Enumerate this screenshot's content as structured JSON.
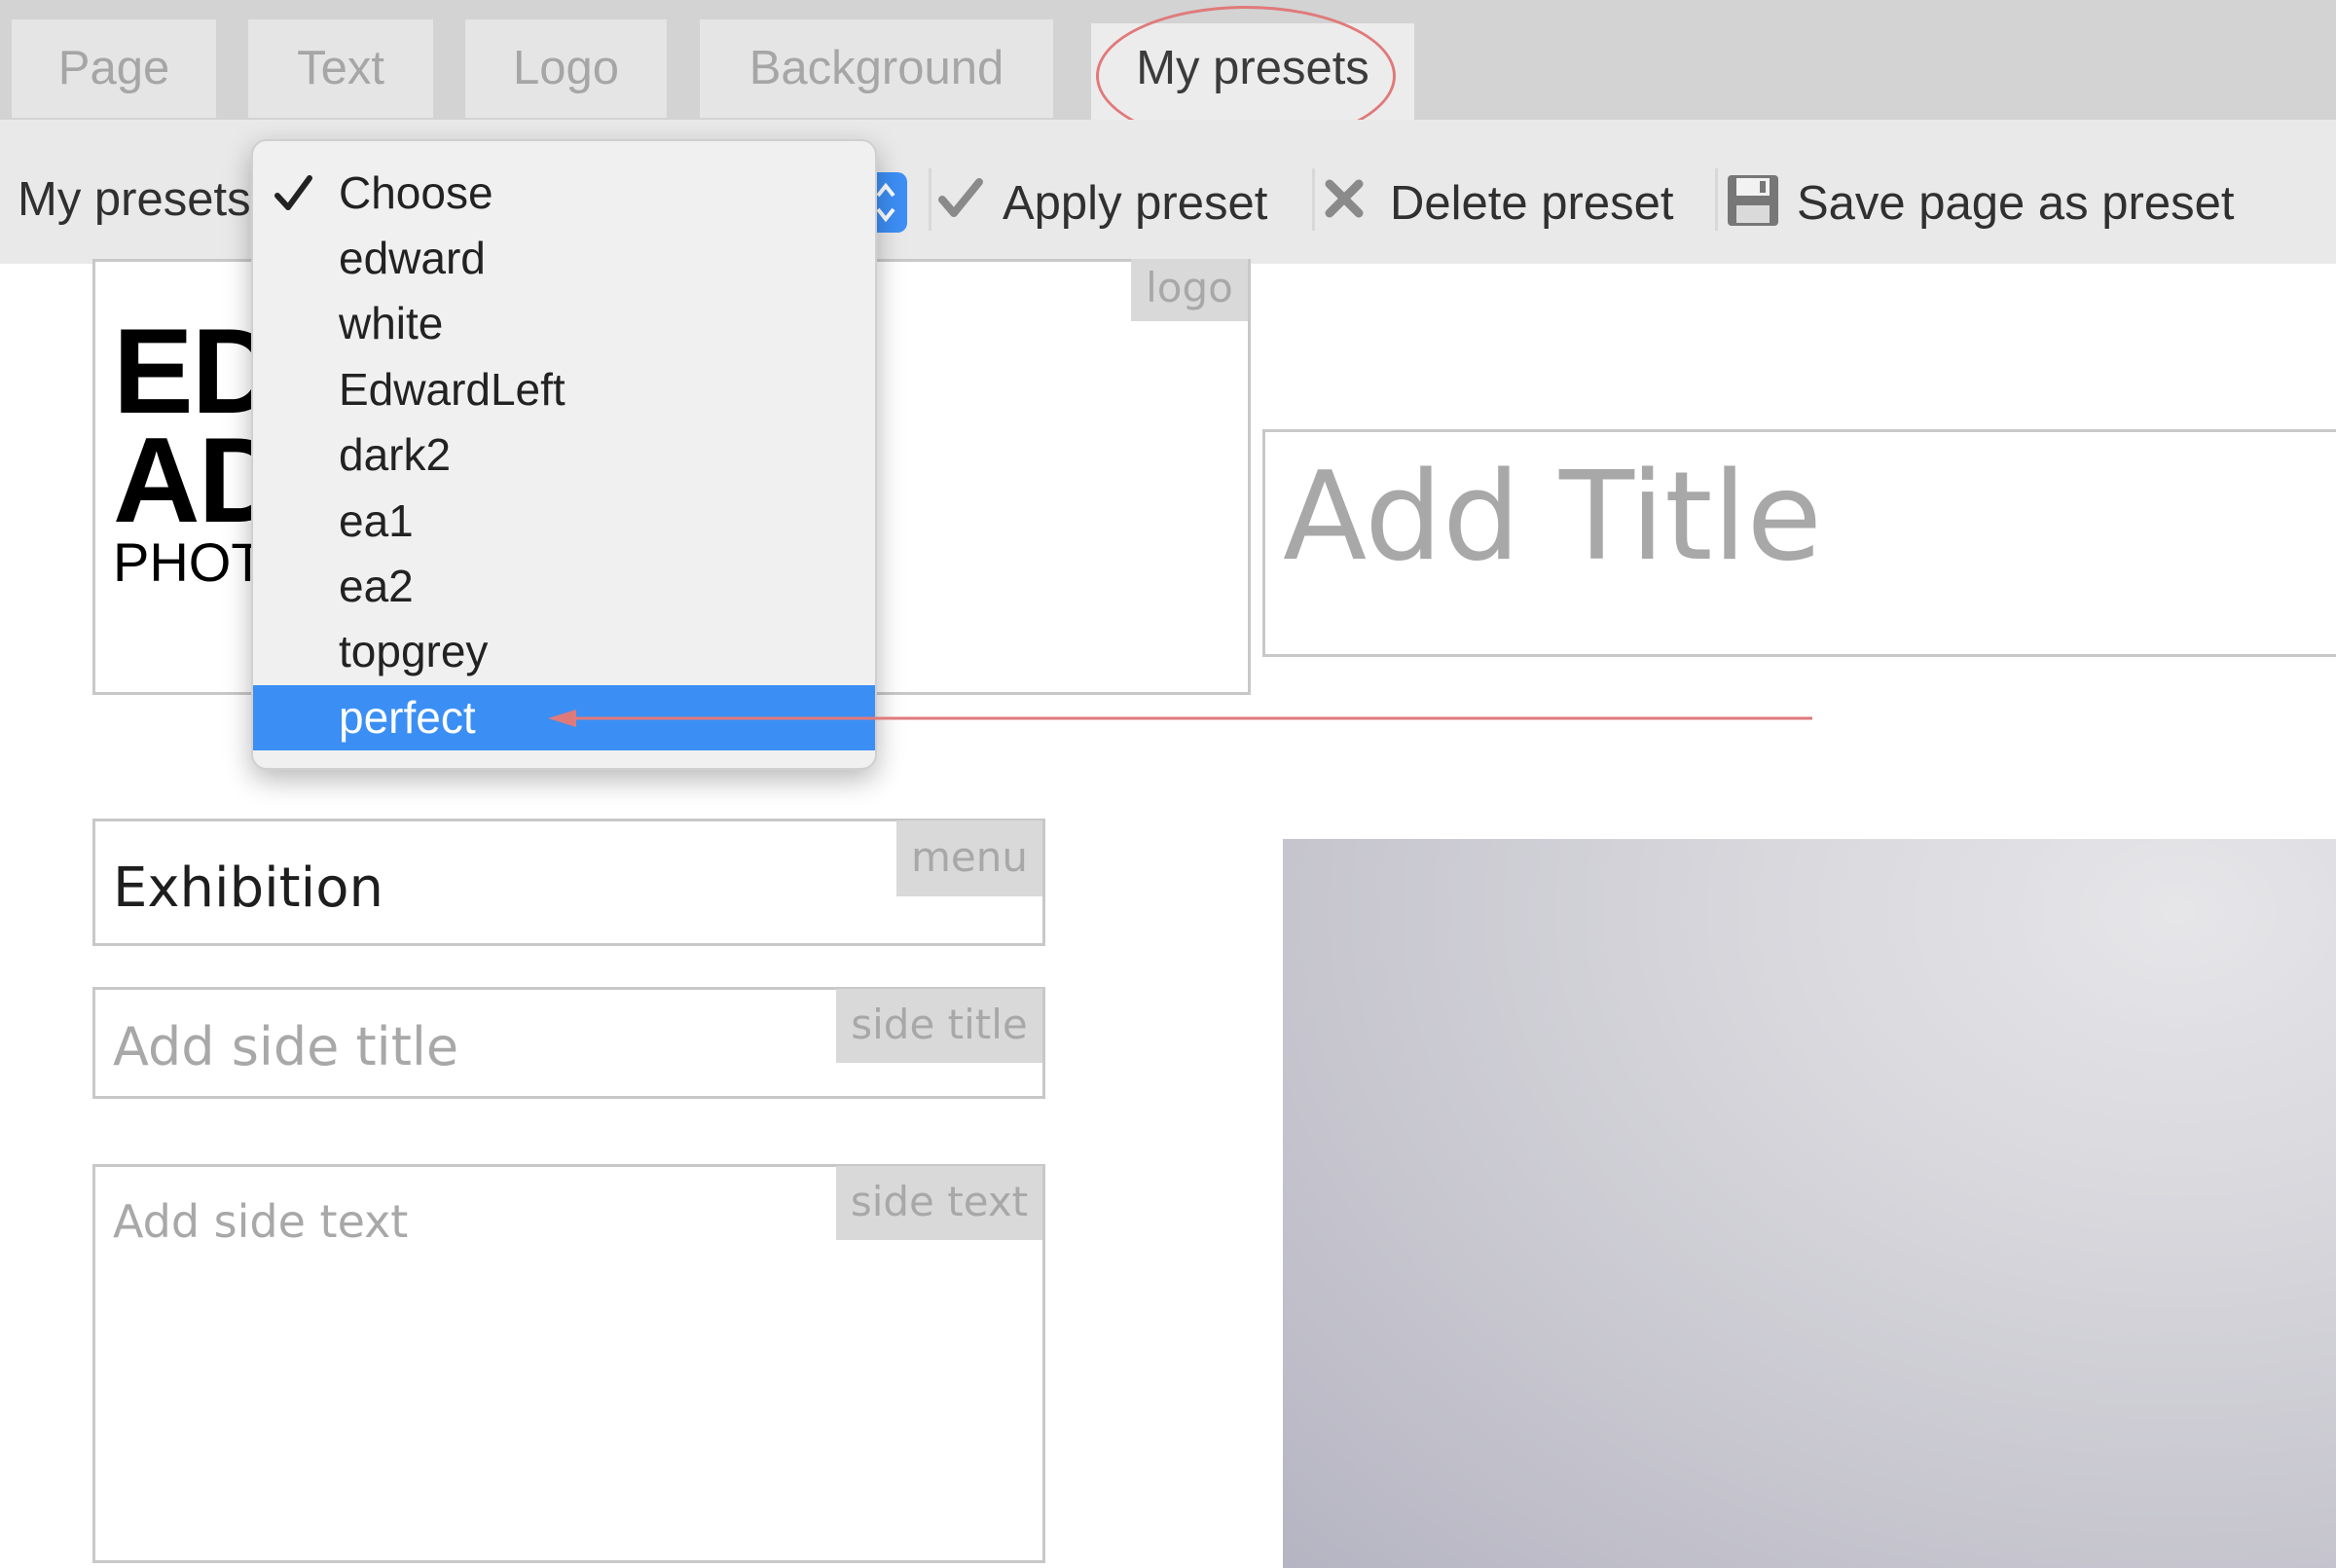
{
  "tabs": [
    {
      "label": "Page",
      "active": false
    },
    {
      "label": "Text",
      "active": false
    },
    {
      "label": "Logo",
      "active": false
    },
    {
      "label": "Background",
      "active": false
    },
    {
      "label": "My presets",
      "active": true
    }
  ],
  "toolbar": {
    "presets_label": "My presets",
    "apply_label": "Apply preset",
    "delete_label": "Delete preset",
    "save_label": "Save page as preset"
  },
  "dropdown": {
    "options": [
      {
        "label": "Choose",
        "checked": true,
        "selected": false
      },
      {
        "label": "edward",
        "checked": false,
        "selected": false
      },
      {
        "label": "white",
        "checked": false,
        "selected": false
      },
      {
        "label": "EdwardLeft",
        "checked": false,
        "selected": false
      },
      {
        "label": "dark2",
        "checked": false,
        "selected": false
      },
      {
        "label": "ea1",
        "checked": false,
        "selected": false
      },
      {
        "label": "ea2",
        "checked": false,
        "selected": false
      },
      {
        "label": "topgrey",
        "checked": false,
        "selected": false
      },
      {
        "label": "perfect",
        "checked": false,
        "selected": true
      }
    ]
  },
  "canvas": {
    "logo_tag": "logo",
    "logo_lines": [
      "ED",
      "AD",
      "PHOT"
    ],
    "title_placeholder": "Add Title",
    "menu_tag": "menu",
    "menu_item": "Exhibition",
    "side_title_tag": "side title",
    "side_title_placeholder": "Add side title",
    "side_text_tag": "side text",
    "side_text_placeholder": "Add side text"
  },
  "colors": {
    "selection": "#3b8ff4",
    "annotation": "#e07a7a",
    "tab_bar": "#d3d3d3",
    "toolbar": "#e9e9e9"
  },
  "icons": {
    "apply": "checkmark-icon",
    "delete": "x-icon",
    "save": "floppy-disk-icon",
    "select": "stepper-icon"
  }
}
